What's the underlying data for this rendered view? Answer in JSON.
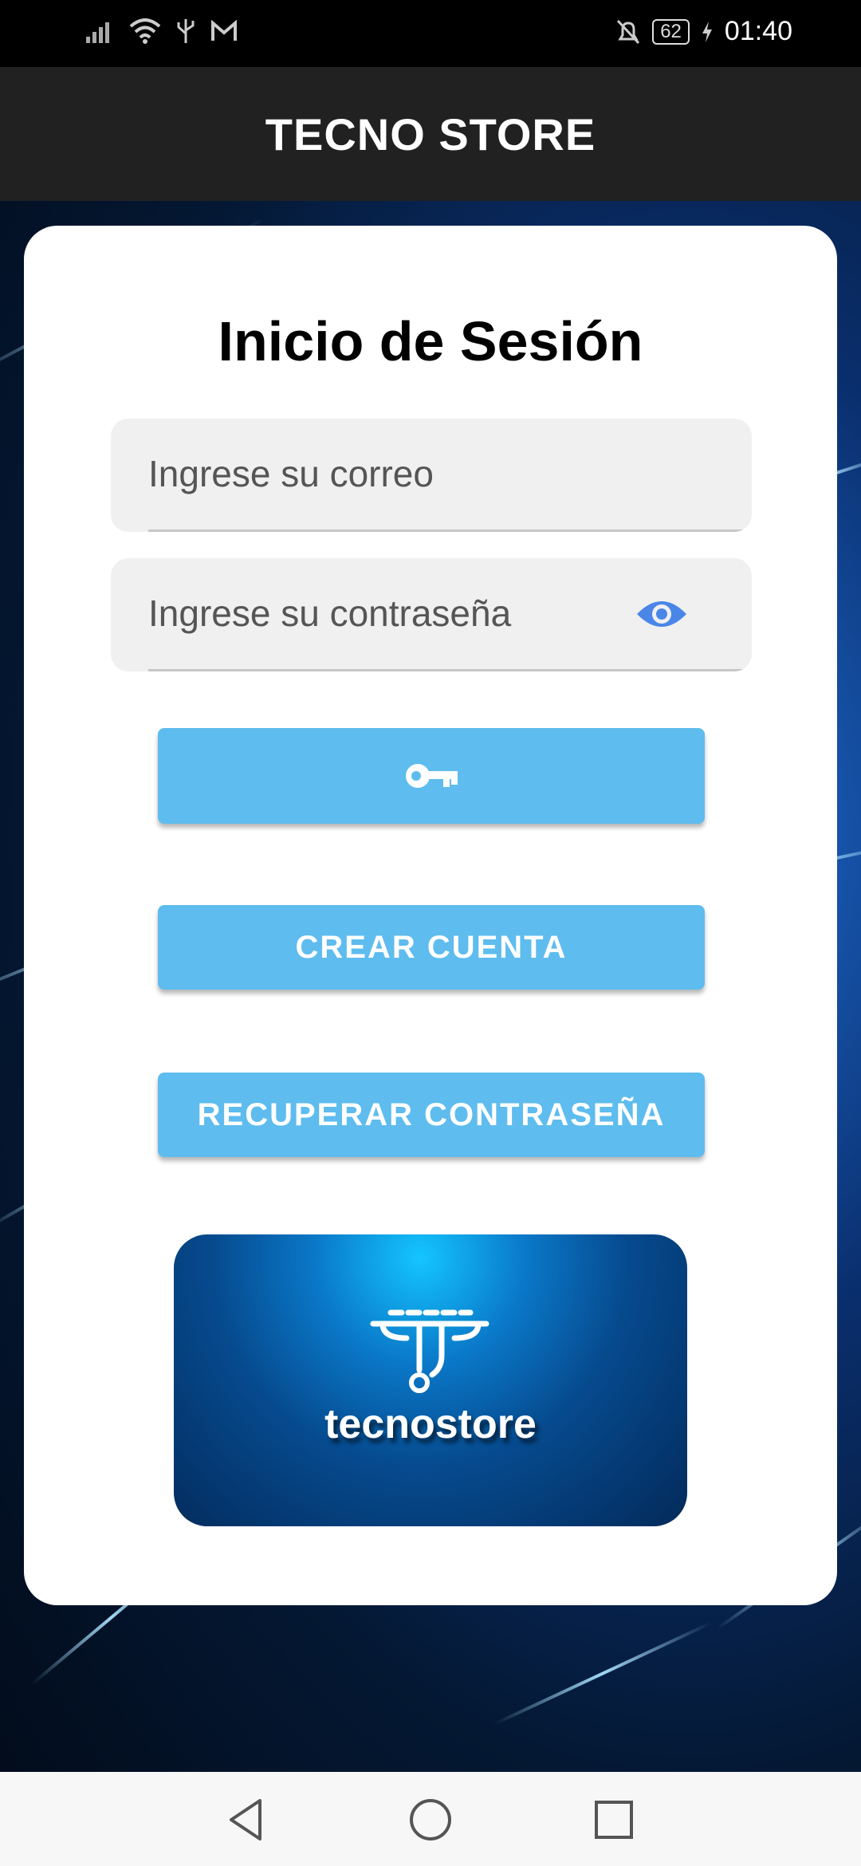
{
  "status_bar": {
    "time": "01:40",
    "battery": "62",
    "icons": [
      "signal-icon",
      "wifi-icon",
      "usb-icon",
      "gmail-icon",
      "bell-off-icon",
      "battery-icon",
      "charging-icon"
    ]
  },
  "app_bar": {
    "title": "TECNO STORE"
  },
  "login": {
    "title": "Inicio de Sesión",
    "email": {
      "placeholder": "Ingrese su correo",
      "value": ""
    },
    "password": {
      "placeholder": "Ingrese su contraseña",
      "value": ""
    },
    "login_button_icon": "key-icon",
    "create_account_label": "CREAR CUENTA",
    "recover_password_label": "RECUPERAR CONTRASEÑA",
    "logo_text": "tecnostore"
  },
  "colors": {
    "app_bar": "#212121",
    "button": "#5ebcee",
    "eye_icon": "#4a86e8",
    "card": "#ffffff"
  },
  "nav_bar": {
    "icons": [
      "back-icon",
      "home-icon",
      "recents-icon"
    ]
  }
}
